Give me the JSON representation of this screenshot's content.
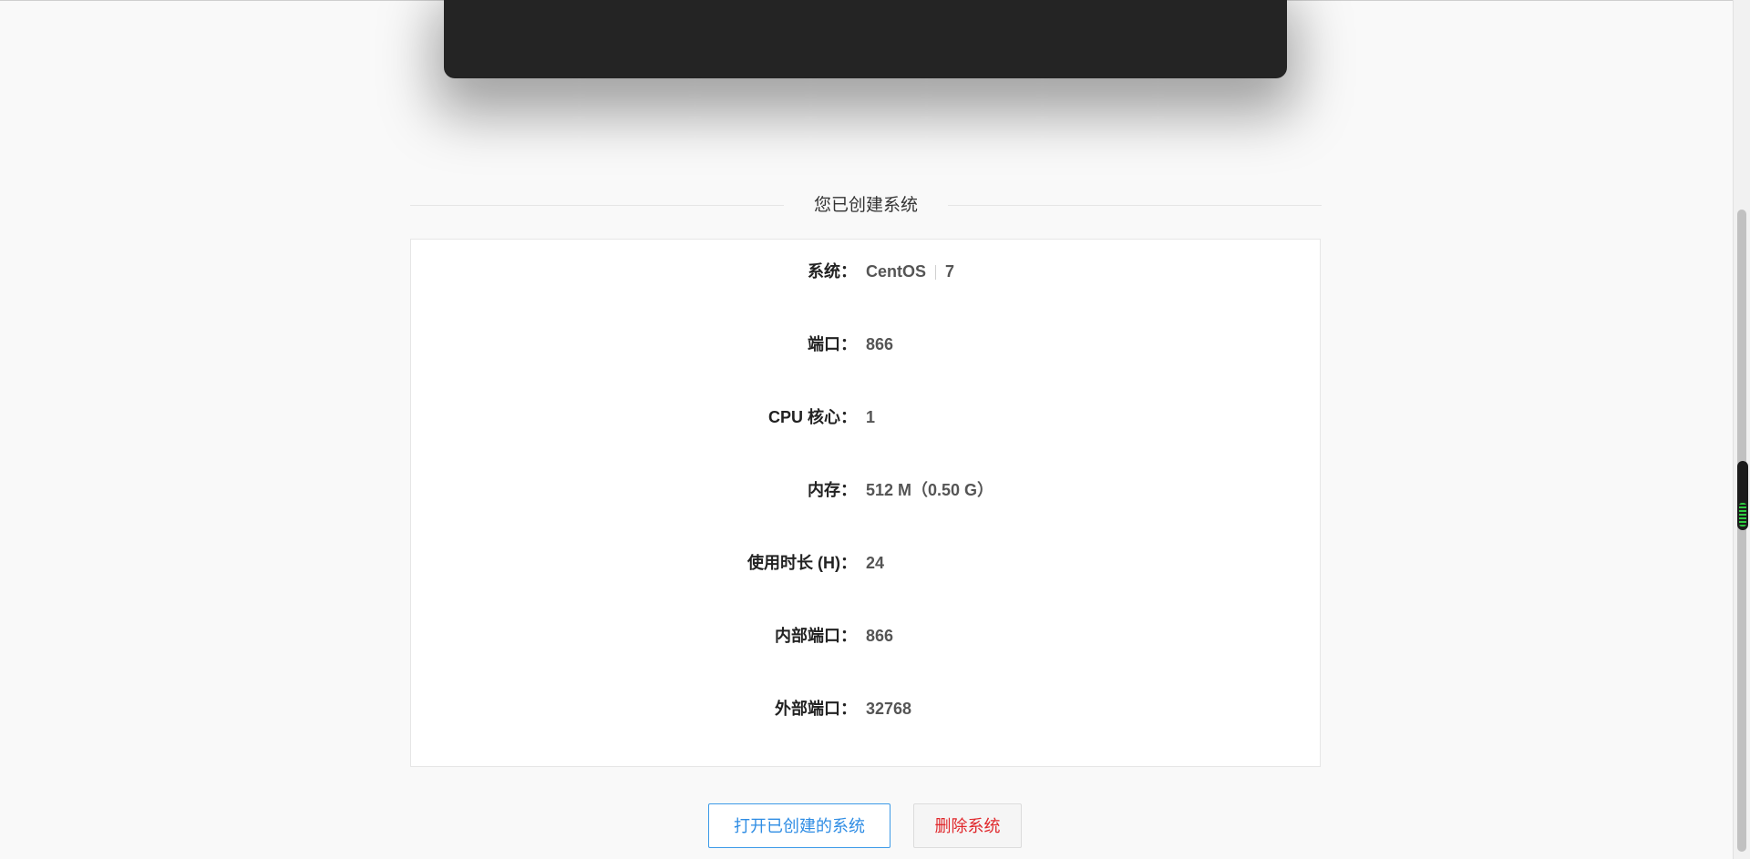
{
  "section_title": "您已创建系统",
  "details": {
    "os_label": "系统：",
    "os_name": "CentOS",
    "os_version": "7",
    "port_label": "端口：",
    "port_value": "866",
    "cpu_label": "CPU 核心：",
    "cpu_value": "1",
    "memory_label": "内存：",
    "memory_value": "512 M（0.50 G）",
    "duration_label": "使用时长 (H)：",
    "duration_value": "24",
    "internal_port_label": "内部端口：",
    "internal_port_value": "866",
    "external_port_label": "外部端口：",
    "external_port_value": "32768"
  },
  "actions": {
    "open_label": "打开已创建的系统",
    "delete_label": "删除系统"
  },
  "colors": {
    "primary": "#2f8de4",
    "danger": "#e0272b",
    "terminal_bg": "#242424"
  }
}
